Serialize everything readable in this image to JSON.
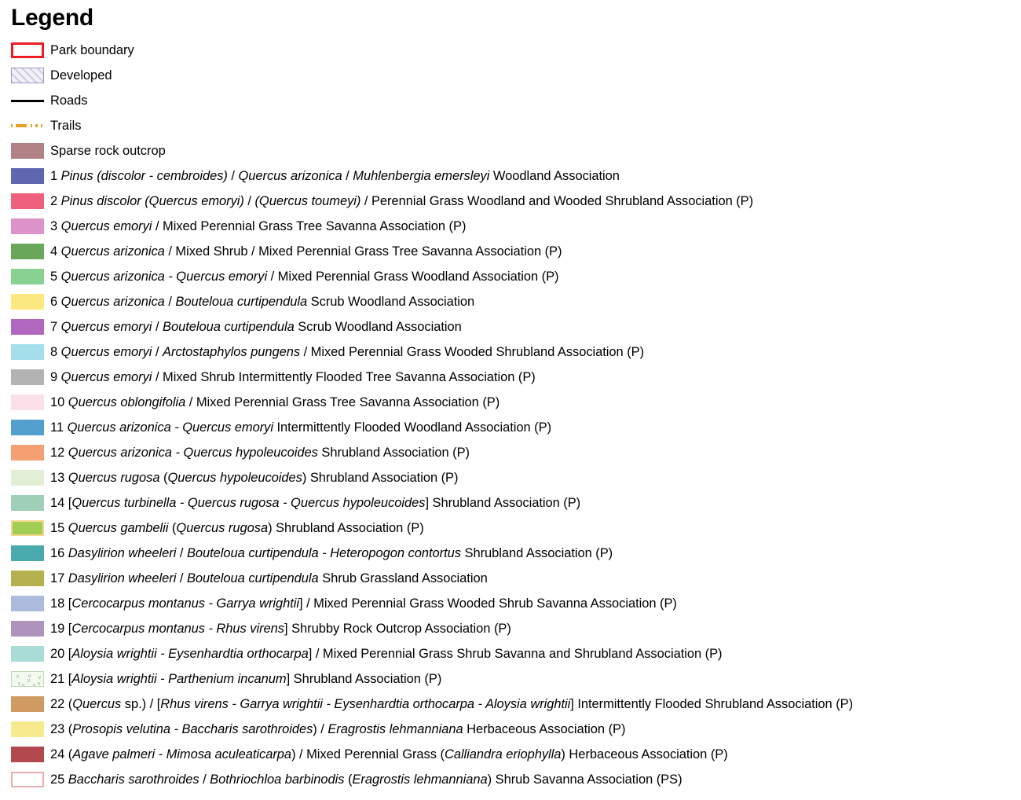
{
  "title": "Legend",
  "colors": {
    "park_boundary_border": "#ed1c24",
    "developed_fill": "#f1f1f7",
    "developed_border": "#9a9ac4",
    "roads": "#000000",
    "trails": "#e8a020"
  },
  "items": [
    {
      "kind": "boundary",
      "swatch_name": "park-boundary-swatch",
      "number": "",
      "text": "Park boundary",
      "html": "Park boundary"
    },
    {
      "kind": "hatch",
      "swatch_name": "developed-swatch",
      "number": "",
      "text": "Developed",
      "html": "Developed"
    },
    {
      "kind": "line-road",
      "swatch_name": "roads-line-swatch",
      "number": "",
      "text": "Roads",
      "html": "Roads"
    },
    {
      "kind": "line-trail",
      "swatch_name": "trails-line-swatch",
      "number": "",
      "text": "Trails",
      "html": "Trails"
    },
    {
      "kind": "fill",
      "swatch_name": "sparse-rock-outcrop-swatch",
      "color": "#b08185",
      "number": "",
      "text": "Sparse rock outcrop",
      "html": "Sparse rock outcrop"
    },
    {
      "kind": "fill",
      "swatch_name": "veg-class-1-swatch",
      "color": "#6067b0",
      "number": "1",
      "text": "1 Pinus (discolor - cembroides) / Quercus arizonica / Muhlenbergia emersleyi Woodland Association",
      "html": "1 <i>Pinus (discolor - cembroides)</i> / <i>Quercus arizonica</i> / <i>Muhlenbergia emersleyi</i> Woodland Association"
    },
    {
      "kind": "fill",
      "swatch_name": "veg-class-2-swatch",
      "color": "#ef607f",
      "number": "2",
      "text": "2 Pinus discolor (Quercus emoryi) / (Quercus toumeyi) / Perennial Grass Woodland and Wooded Shrubland Association (P)",
      "html": "2 <i>Pinus discolor (Quercus emoryi)</i> / <i>(Quercus toumeyi)</i> / Perennial Grass Woodland and Wooded Shrubland Association (P)"
    },
    {
      "kind": "fill",
      "swatch_name": "veg-class-3-swatch",
      "color": "#dd93c9",
      "number": "3",
      "text": "3 Quercus emoryi / Mixed Perennial Grass Tree Savanna Association (P)",
      "html": "3 <i>Quercus emoryi</i> / Mixed Perennial Grass Tree Savanna Association (P)"
    },
    {
      "kind": "fill",
      "swatch_name": "veg-class-4-swatch",
      "color": "#69a75b",
      "number": "4",
      "text": "4 Quercus arizonica / Mixed Shrub / Mixed Perennial Grass Tree Savanna Association (P)",
      "html": "4 <i>Quercus arizonica</i> / Mixed Shrub / Mixed Perennial Grass Tree Savanna Association (P)"
    },
    {
      "kind": "fill",
      "swatch_name": "veg-class-5-swatch",
      "color": "#89d192",
      "number": "5",
      "text": "5 Quercus arizonica - Quercus emoryi / Mixed Perennial Grass Woodland Association (P)",
      "html": "5 <i>Quercus arizonica - Quercus emoryi</i> / Mixed Perennial Grass Woodland Association (P)"
    },
    {
      "kind": "fill",
      "swatch_name": "veg-class-6-swatch",
      "color": "#fbe87e",
      "number": "6",
      "text": "6 Quercus arizonica / Bouteloua curtipendula Scrub Woodland Association",
      "html": "6 <i>Quercus arizonica</i> / <i>Bouteloua curtipendula</i> Scrub Woodland Association"
    },
    {
      "kind": "fill",
      "swatch_name": "veg-class-7-swatch",
      "color": "#b268bf",
      "number": "7",
      "text": "7 Quercus emoryi / Bouteloua curtipendula Scrub Woodland Association",
      "html": "7 <i>Quercus emoryi</i> / <i>Bouteloua curtipendula</i> Scrub Woodland Association"
    },
    {
      "kind": "fill",
      "swatch_name": "veg-class-8-swatch",
      "color": "#a5dfeb",
      "number": "8",
      "text": "8 Quercus emoryi / Arctostaphylos pungens / Mixed Perennial Grass Wooded Shrubland Association (P)",
      "html": "8 <i>Quercus emoryi</i> / <i>Arctostaphylos pungens</i> / Mixed Perennial Grass Wooded Shrubland Association (P)"
    },
    {
      "kind": "fill",
      "swatch_name": "veg-class-9-swatch",
      "color": "#b3b3b3",
      "number": "9",
      "text": "9 Quercus emoryi / Mixed Shrub Intermittently Flooded Tree Savanna Association (P)",
      "html": "9 <i>Quercus emoryi</i> / Mixed Shrub Intermittently Flooded Tree Savanna Association (P)"
    },
    {
      "kind": "fill",
      "swatch_name": "veg-class-10-swatch",
      "color": "#fbdfe9",
      "number": "10",
      "text": "10 Quercus oblongifolia / Mixed Perennial Grass Tree Savanna Association (P)",
      "html": "10 <i>Quercus oblongifolia</i> / Mixed Perennial Grass Tree Savanna Association (P)"
    },
    {
      "kind": "fill",
      "swatch_name": "veg-class-11-swatch",
      "color": "#539fce",
      "number": "11",
      "text": "11 Quercus arizonica - Quercus emoryi Intermittently Flooded Woodland Association (P)",
      "html": "11 <i>Quercus arizonica - Quercus emoryi</i> Intermittently Flooded Woodland Association (P)"
    },
    {
      "kind": "fill",
      "swatch_name": "veg-class-12-swatch",
      "color": "#f4a072",
      "number": "12",
      "text": "12 Quercus arizonica - Quercus hypoleucoides Shrubland Association (P)",
      "html": "12 <i>Quercus arizonica - Quercus hypoleucoides</i> Shrubland Association (P)"
    },
    {
      "kind": "fill",
      "swatch_name": "veg-class-13-swatch",
      "color": "#e3eed7",
      "number": "13",
      "text": "13 Quercus rugosa (Quercus hypoleucoides) Shrubland Association (P)",
      "html": "13 <i>Quercus rugosa</i> (<i>Quercus hypoleucoides</i>) Shrubland Association (P)"
    },
    {
      "kind": "fill",
      "swatch_name": "veg-class-14-swatch",
      "color": "#9fcfb9",
      "number": "14",
      "text": "14 [Quercus turbinella - Quercus rugosa - Quercus hypoleucoides] Shrubland Association (P)",
      "html": "14 [<i>Quercus turbinella - Quercus rugosa - Quercus hypoleucoides</i>] Shrubland Association (P)"
    },
    {
      "kind": "fill-bordered",
      "swatch_name": "veg-class-15-swatch",
      "color": "#a0cd52",
      "border_color": "#f5d78e",
      "number": "15",
      "text": "15 Quercus gambelii (Quercus rugosa) Shrubland Association (P)",
      "html": "15 <i>Quercus gambelii</i> (<i>Quercus rugosa</i>) Shrubland Association (P)"
    },
    {
      "kind": "fill",
      "swatch_name": "veg-class-16-swatch",
      "color": "#4aabae",
      "number": "16",
      "text": "16 Dasylirion wheeleri / Bouteloua curtipendula - Heteropogon contortus Shrubland Association (P)",
      "html": "16 <i>Dasylirion wheeleri</i> / <i>Bouteloua curtipendula - Heteropogon contortus</i> Shrubland Association (P)"
    },
    {
      "kind": "fill",
      "swatch_name": "veg-class-17-swatch",
      "color": "#b5b14e",
      "number": "17",
      "text": "17 Dasylirion wheeleri / Bouteloua curtipendula Shrub Grassland Association",
      "html": "17 <i>Dasylirion wheeleri</i> / <i>Bouteloua curtipendula</i> Shrub Grassland Association"
    },
    {
      "kind": "fill",
      "swatch_name": "veg-class-18-swatch",
      "color": "#adbcdd",
      "number": "18",
      "text": "18 [Cercocarpus montanus - Garrya wrightii] / Mixed Perennial Grass Wooded Shrub Savanna Association (P)",
      "html": "18 [<i>Cercocarpus montanus - Garrya wrightii</i>] / Mixed Perennial Grass Wooded Shrub Savanna Association (P)"
    },
    {
      "kind": "fill",
      "swatch_name": "veg-class-19-swatch",
      "color": "#ae93bc",
      "number": "19",
      "text": "19 [Cercocarpus montanus - Rhus virens] Shrubby Rock Outcrop Association (P)",
      "html": "19 [<i>Cercocarpus montanus - Rhus virens</i>] Shrubby Rock Outcrop Association (P)"
    },
    {
      "kind": "fill",
      "swatch_name": "veg-class-20-swatch",
      "color": "#a9dcd7",
      "number": "20",
      "text": "20 [Aloysia wrightii - Eysenhardtia orthocarpa] / Mixed Perennial Grass Shrub Savanna and Shrubland Association (P)",
      "html": "20 [<i>Aloysia wrightii - Eysenhardtia orthocarpa</i>] / Mixed Perennial Grass Shrub Savanna and Shrubland Association (P)"
    },
    {
      "kind": "pattern",
      "swatch_name": "veg-class-21-swatch",
      "color": "#f4faf0",
      "border_color": "#bcd9b4",
      "number": "21",
      "text": "21 [Aloysia wrightii - Parthenium incanum] Shrubland Association (P)",
      "html": "21 [<i>Aloysia wrightii - Parthenium incanum</i>] Shrubland Association (P)"
    },
    {
      "kind": "fill",
      "swatch_name": "veg-class-22-swatch",
      "color": "#d09a63",
      "number": "22",
      "text": "22 (Quercus sp.) / [Rhus virens - Garrya wrightii - Eysenhardtia orthocarpa - Aloysia wrightii] Intermittently Flooded Shrubland Association (P)",
      "html": "22 (<i>Quercus</i> sp.) / [<i>Rhus virens - Garrya wrightii - Eysenhardtia orthocarpa - Aloysia wrightii</i>] Intermittently Flooded Shrubland Association (P)"
    },
    {
      "kind": "fill",
      "swatch_name": "veg-class-23-swatch",
      "color": "#f7ea8e",
      "number": "23",
      "text": "23 (Prosopis velutina - Baccharis sarothroides) / Eragrostis lehmanniana Herbaceous Association (P)",
      "html": "23 (<i>Prosopis velutina - Baccharis sarothroides</i>) / <i>Eragrostis lehmanniana</i> Herbaceous Association (P)"
    },
    {
      "kind": "fill",
      "swatch_name": "veg-class-24-swatch",
      "color": "#b2494e",
      "number": "24",
      "text": "24 (Agave palmeri - Mimosa aculeaticarpa) / Mixed Perennial Grass (Calliandra eriophylla) Herbaceous Association (P)",
      "html": "24 (<i>Agave palmeri - Mimosa aculeaticarpa</i>) / Mixed Perennial Grass (<i>Calliandra eriophylla</i>) Herbaceous Association (P)"
    },
    {
      "kind": "fill-bordered",
      "swatch_name": "veg-class-25-swatch",
      "color": "#ffffff",
      "border_color": "#eeadb0",
      "number": "25",
      "text": "25 Baccharis sarothroides / Bothriochloa barbinodis (Eragrostis lehmanniana) Shrub Savanna Association (PS)",
      "html": "25 <i>Baccharis sarothroides</i> / <i>Bothriochloa barbinodis</i> (<i>Eragrostis lehmanniana</i>) Shrub Savanna Association (PS)"
    }
  ]
}
